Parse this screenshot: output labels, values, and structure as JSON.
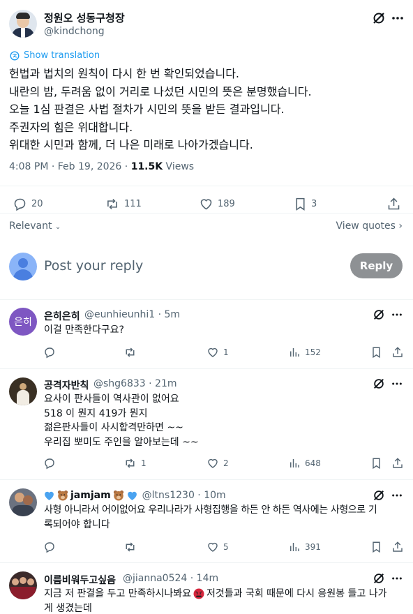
{
  "post": {
    "author_name": "정원오 성동구청장",
    "author_handle": "@kindchong",
    "show_translation": "Show translation",
    "lines": [
      "헌법과 법치의 원칙이 다시 한 번 확인되었습니다.",
      "내란의 밤, 두려움 없이 거리로 나섰던 시민의 뜻은 분명했습니다.",
      "오늘 1심 판결은 사법 절차가 시민의 뜻을 받든 결과입니다.",
      "주권자의 힘은 위대합니다.",
      "위대한 시민과 함께, 더 나은 미래로 나아가겠습니다."
    ],
    "timestamp": "4:08 PM · Feb 19, 2026 · ",
    "views_count": "11.5K",
    "views_label": " Views",
    "replies": "20",
    "reposts": "111",
    "likes": "189",
    "bookmarks": "3"
  },
  "sort": {
    "relevant": "Relevant",
    "view_quotes": "View quotes"
  },
  "composer": {
    "placeholder": "Post your reply",
    "reply_button": "Reply"
  },
  "replies": [
    {
      "name": "은히은히",
      "handle": "@eunhieunhi1 · 5m",
      "avatar_text": "은히",
      "lines": [
        "이걸 만족한다구요?"
      ],
      "replies": "",
      "reposts": "",
      "likes": "1",
      "views": "152"
    },
    {
      "name": "공격자반칙",
      "handle": "@shg6833 · 21m",
      "lines": [
        "요사이 판사들이 역사관이 없어요",
        "518 이 뭔지 419가 뭔지",
        "젊은판사들이 사시합격만하면 ~~",
        "우리집 뽀미도 주인을 알아보는데 ~~"
      ],
      "replies": "",
      "reposts": "1",
      "likes": "2",
      "views": "648"
    },
    {
      "name": "jamjam",
      "handle": "@ltns1230 · 10m",
      "lines": [
        "사형 아니라서 어이없어요 우리나라가 사형집행을 하든 안 하든 역사에는 사형으로 기",
        "록되어야 합니다"
      ],
      "replies": "",
      "reposts": "",
      "likes": "5",
      "views": "391"
    },
    {
      "name": "이름비워두고싶음",
      "handle": "@jianna0524 · 14m",
      "lines": [
        "지금 저 판결을 두고 만족하시나봐요",
        " 저것들과 국회 때문에 다시 응원봉 들고 나가",
        "게 생겼는데"
      ]
    }
  ],
  "colors": {
    "accent": "#1d9bf0",
    "muted": "#536471",
    "reply_button": "#8e9194"
  }
}
